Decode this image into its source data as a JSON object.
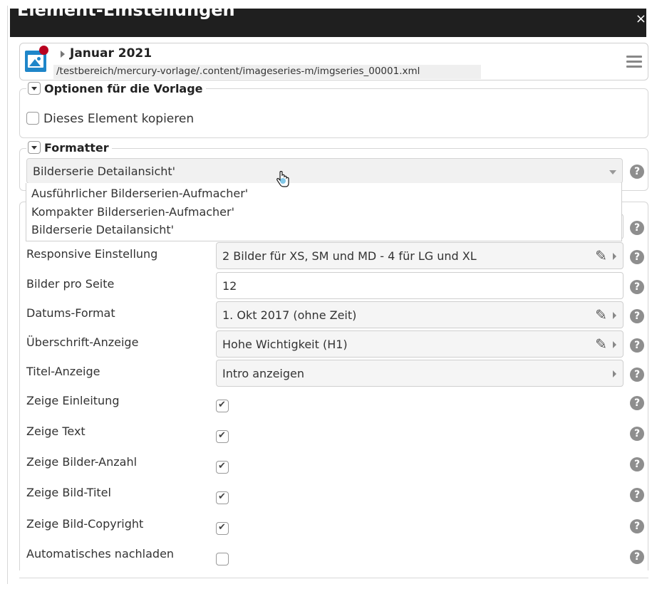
{
  "dialog": {
    "title": "Element-Einstellungen",
    "close_label": "×"
  },
  "header": {
    "title": "Januar 2021",
    "path": "/testbereich/mercury-vorlage/.content/imageseries-m/imgseries_00001.xml"
  },
  "template_options": {
    "legend": "Optionen für die Vorlage",
    "copy_label": "Dieses Element kopieren",
    "copy_checked": false
  },
  "formatter": {
    "legend": "Formatter",
    "selected": "Bilderserie Detailansicht'",
    "options": [
      "Ausführlicher Bilderserien-Aufmacher'",
      "Kompakter Bilderserien-Aufmacher'",
      "Bilderserie Detailansicht'"
    ]
  },
  "settings": {
    "responsive": {
      "label": "Responsive Einstellung",
      "value": "2 Bilder für XS, SM und MD - 4 für LG und XL"
    },
    "per_page": {
      "label": "Bilder pro Seite",
      "value": "12"
    },
    "date_format": {
      "label": "Datums-Format",
      "value": "1. Okt 2017 (ohne Zeit)"
    },
    "heading": {
      "label": "Überschrift-Anzeige",
      "value": "Hohe Wichtigkeit (H1)"
    },
    "title_display": {
      "label": "Titel-Anzeige",
      "value": "Intro anzeigen"
    },
    "checkboxes": [
      {
        "label": "Zeige Einleitung",
        "checked": true
      },
      {
        "label": "Zeige Text",
        "checked": true
      },
      {
        "label": "Zeige Bilder-Anzahl",
        "checked": true
      },
      {
        "label": "Zeige Bild-Titel",
        "checked": true
      },
      {
        "label": "Zeige Bild-Copyright",
        "checked": true
      },
      {
        "label": "Automatisches nachladen",
        "checked": false
      }
    ]
  },
  "icons": {
    "help": "?",
    "pencil": "✎"
  }
}
